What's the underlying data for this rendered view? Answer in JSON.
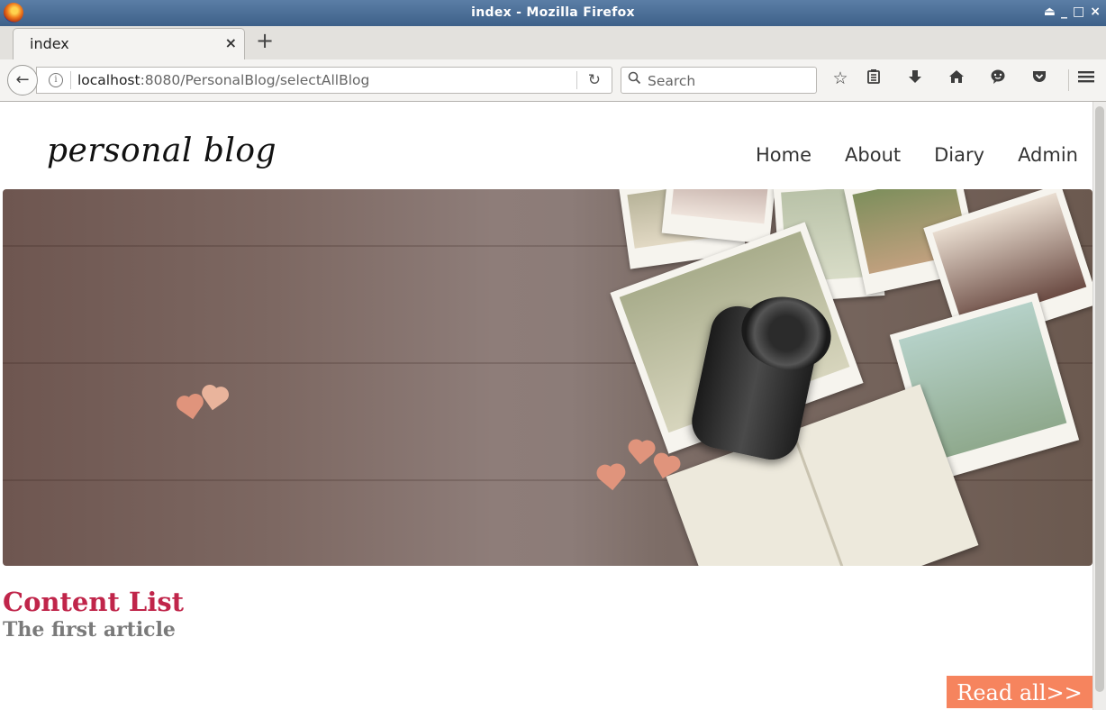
{
  "window": {
    "title": "index - Mozilla Firefox",
    "controls": [
      "⏏",
      "_",
      "□",
      "×"
    ]
  },
  "tab": {
    "title": "index",
    "close": "×",
    "new_tab": "+"
  },
  "navbar": {
    "url_host": "localhost",
    "url_rest": ":8080/PersonalBlog/selectAllBlog",
    "search_placeholder": "Search"
  },
  "site": {
    "logo": "personal blog",
    "nav": [
      "Home",
      "About",
      "Diary",
      "Admin"
    ]
  },
  "content": {
    "section_title": "Content List",
    "article_title": "The first article",
    "read_all": "Read all>>"
  },
  "colors": {
    "accent": "#c0254a",
    "button": "#f6845e",
    "article_title": "#7a7a7a"
  }
}
